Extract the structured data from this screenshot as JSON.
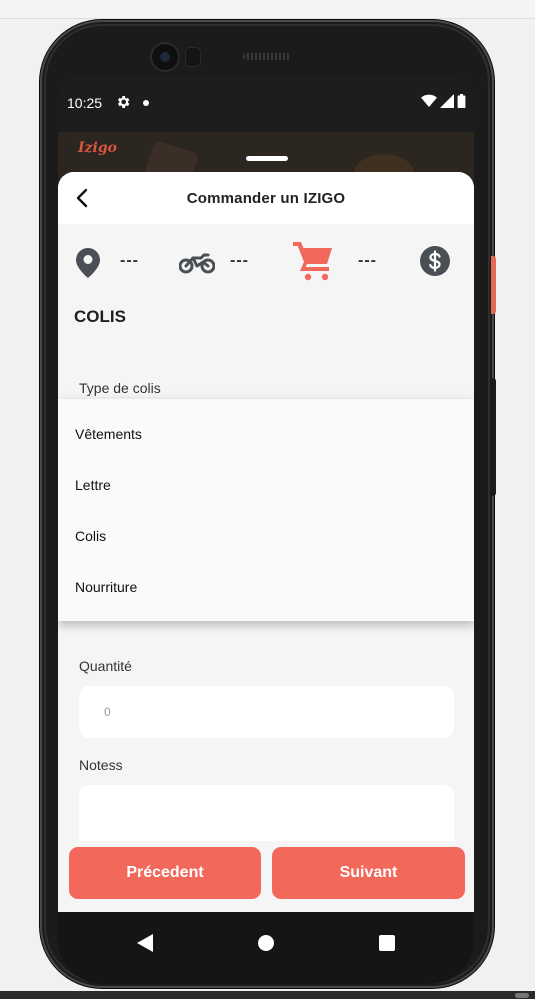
{
  "status_bar": {
    "time": "10:25"
  },
  "header": {
    "title": "Commander un IZIGO"
  },
  "steps": [
    {
      "icon": "location-pin-icon",
      "value": "---"
    },
    {
      "icon": "motorcycle-icon",
      "value": "---"
    },
    {
      "icon": "cart-icon",
      "value": "---",
      "active": true
    },
    {
      "icon": "dollar-icon"
    }
  ],
  "section": {
    "title": "COLIS"
  },
  "form": {
    "type_label": "Type de colis",
    "quantity_label": "Quantité",
    "quantity_value": "0",
    "notes_label": "Notess"
  },
  "dropdown": {
    "options": [
      "Vêtements",
      "Lettre",
      "Colis",
      "Nourriture"
    ]
  },
  "actions": {
    "previous": "Précedent",
    "next": "Suivant"
  },
  "behind_app": {
    "logo": "Izigo"
  },
  "colors": {
    "accent": "#f2685a",
    "icon_gray": "#4a4f55"
  }
}
